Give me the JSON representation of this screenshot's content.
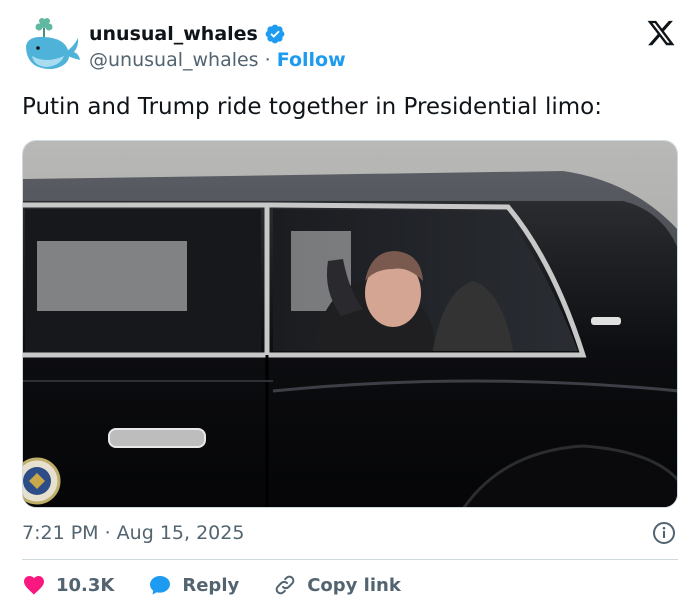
{
  "author": {
    "display_name": "unusual_whales",
    "handle": "@unusual_whales",
    "separator": "·",
    "follow_label": "Follow"
  },
  "tweet": {
    "text": "Putin and Trump ride together in Presidential limo:"
  },
  "meta": {
    "timestamp": "7:21 PM · Aug 15, 2025"
  },
  "actions": {
    "likes": "10.3K",
    "reply_label": "Reply",
    "copy_label": "Copy link"
  },
  "colors": {
    "accent": "#1d9bf0",
    "like": "#f91880",
    "muted": "#536471"
  },
  "icons": [
    "whale-avatar-icon",
    "verified-badge-icon",
    "x-logo-icon",
    "info-icon",
    "heart-icon",
    "reply-bubble-icon",
    "link-icon",
    "presidential-seal-icon"
  ]
}
